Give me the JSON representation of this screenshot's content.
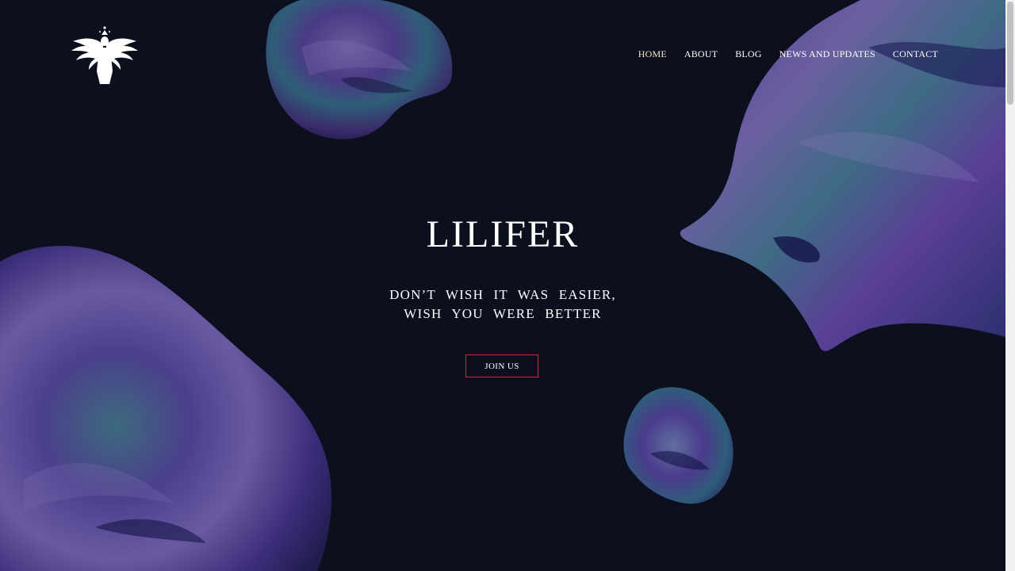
{
  "brand": {
    "logo_icon": "winged-figure-logo-icon"
  },
  "nav": {
    "items": [
      {
        "label": "HOME",
        "active": true
      },
      {
        "label": "ABOUT",
        "active": false
      },
      {
        "label": "BLOG",
        "active": false
      },
      {
        "label": "NEWS AND UPDATES",
        "active": false
      },
      {
        "label": "CONTACT",
        "active": false
      }
    ]
  },
  "hero": {
    "title": "LILIFER",
    "subtitle_line1": "DON’T WISH IT WAS EASIER,",
    "subtitle_line2": "WISH YOU WERE BETTER",
    "cta_label": "JOIN US"
  },
  "colors": {
    "background": "#0c0f1e",
    "accent_border": "#c0323a",
    "nav_active": "#f3e4c5",
    "blob_purple": "#5b3a9e",
    "blob_teal": "#2b6a78"
  }
}
